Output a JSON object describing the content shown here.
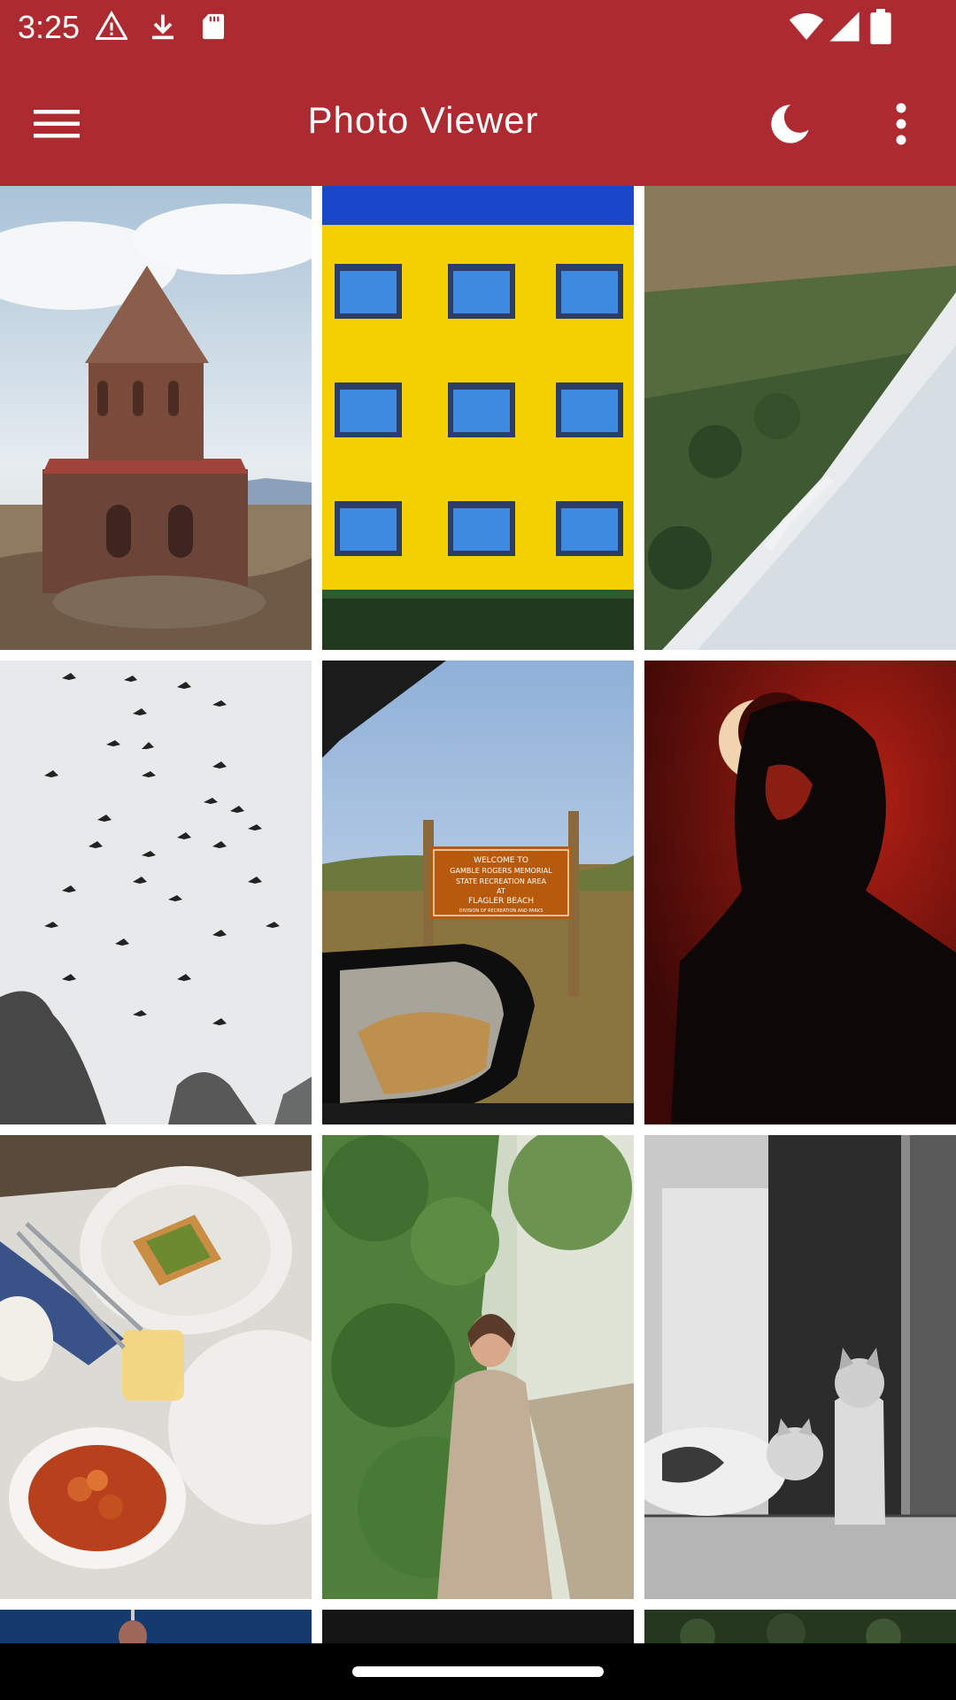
{
  "status_bar": {
    "time": "3:25",
    "icons": [
      "alert-icon",
      "download-icon",
      "sd-card-icon",
      "wifi-icon",
      "signal-icon",
      "battery-icon"
    ]
  },
  "app_bar": {
    "title": "Photo Viewer",
    "menu_icon": "hamburger-menu-icon",
    "theme_icon": "moon-icon",
    "overflow_icon": "more-vert-icon",
    "color": "#ad2a30"
  },
  "photos": [
    {
      "label": "Stone church with conical roof on rocky plateau"
    },
    {
      "label": "Yellow building facade with blue windows"
    },
    {
      "label": "Aerial view of forest beside snowy river"
    },
    {
      "label": "Flock of birds in pale sky"
    },
    {
      "label": "Park sign seen from car window",
      "sign_text": [
        "WELCOME TO",
        "GAMBLE ROGERS MEMORIAL",
        "STATE RECREATION AREA",
        "AT",
        "FLAGLER BEACH",
        "DIVISION OF RECREATION AND PARKS"
      ]
    },
    {
      "label": "Silhouette of woman against red background"
    },
    {
      "label": "Breakfast table with avocado toast and juice"
    },
    {
      "label": "Woman in beige coat beside green hedge"
    },
    {
      "label": "Two cats sitting at shop doorway"
    },
    {
      "label": "Dome against blue sky"
    },
    {
      "label": "Dark photo"
    },
    {
      "label": "Forest tops"
    }
  ]
}
